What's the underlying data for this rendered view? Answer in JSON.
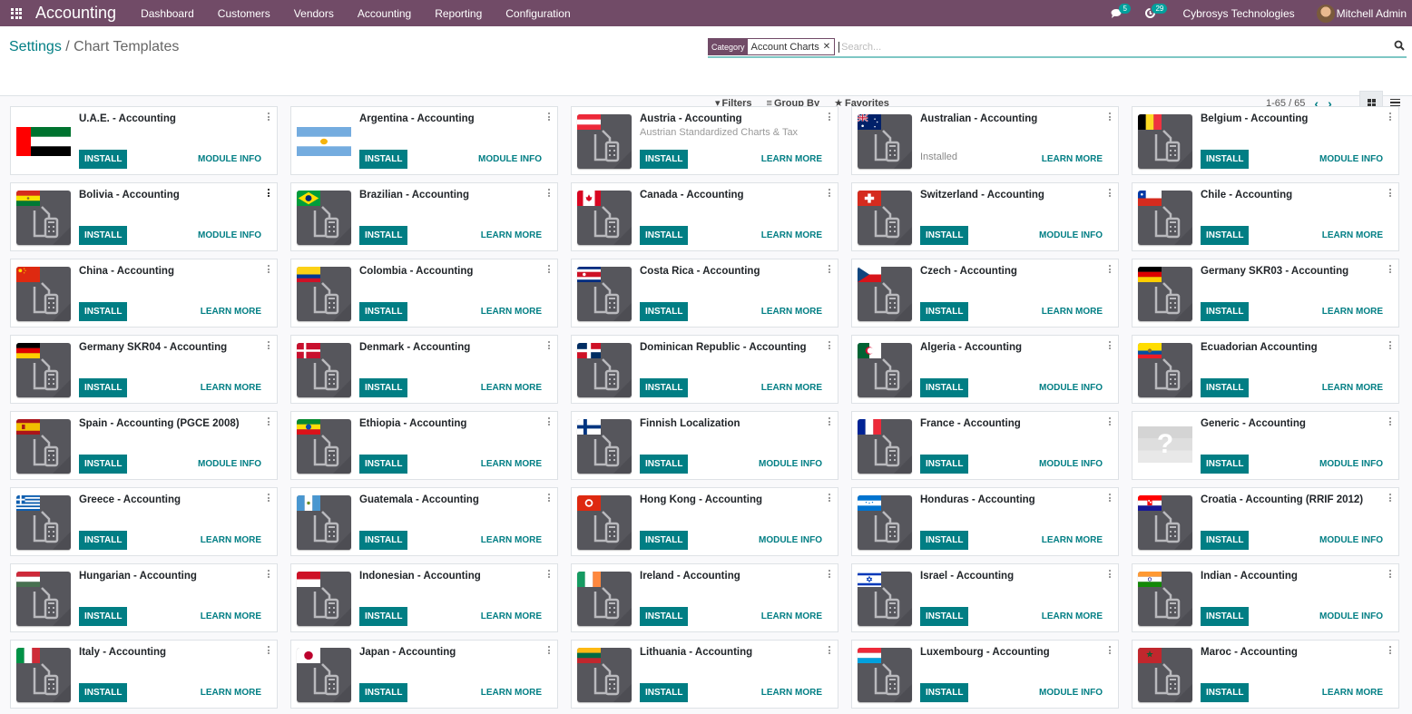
{
  "navbar": {
    "app_title": "Accounting",
    "menu": [
      "Dashboard",
      "Customers",
      "Vendors",
      "Accounting",
      "Reporting",
      "Configuration"
    ],
    "messages_count": "5",
    "activities_count": "29",
    "company": "Cybrosys Technologies",
    "user": "Mitchell Admin"
  },
  "breadcrumb": {
    "parent": "Settings",
    "separator": "/",
    "current": "Chart Templates"
  },
  "search": {
    "facet_label": "Category",
    "facet_value": "Account Charts",
    "placeholder": "Search..."
  },
  "filters": {
    "filters_label": "Filters",
    "groupby_label": "Group By",
    "favorites_label": "Favorites"
  },
  "pager": {
    "text": "1-65 / 65"
  },
  "colors": {
    "brand": "#714b67",
    "primary": "#017e84"
  },
  "cards": [
    {
      "title": "U.A.E. - Accounting",
      "action": "INSTALL",
      "link": "MODULE INFO",
      "flag": "ae",
      "large": true
    },
    {
      "title": "Argentina - Accounting",
      "action": "INSTALL",
      "link": "MODULE INFO",
      "flag": "ar",
      "large": true
    },
    {
      "title": "Austria - Accounting",
      "summary": "Austrian Standardized Charts & Tax",
      "action": "INSTALL",
      "link": "LEARN MORE",
      "flag": "at"
    },
    {
      "title": "Australian - Accounting",
      "status": "Installed",
      "link": "LEARN MORE",
      "flag": "au"
    },
    {
      "title": "Belgium - Accounting",
      "action": "INSTALL",
      "link": "MODULE INFO",
      "flag": "be"
    },
    {
      "title": "Bolivia - Accounting",
      "action": "INSTALL",
      "link": "MODULE INFO",
      "flag": "bo"
    },
    {
      "title": "Brazilian - Accounting",
      "action": "INSTALL",
      "link": "LEARN MORE",
      "flag": "br"
    },
    {
      "title": "Canada - Accounting",
      "action": "INSTALL",
      "link": "LEARN MORE",
      "flag": "ca"
    },
    {
      "title": "Switzerland - Accounting",
      "action": "INSTALL",
      "link": "MODULE INFO",
      "flag": "ch"
    },
    {
      "title": "Chile - Accounting",
      "action": "INSTALL",
      "link": "LEARN MORE",
      "flag": "cl"
    },
    {
      "title": "China - Accounting",
      "action": "INSTALL",
      "link": "LEARN MORE",
      "flag": "cn"
    },
    {
      "title": "Colombia - Accounting",
      "action": "INSTALL",
      "link": "LEARN MORE",
      "flag": "co"
    },
    {
      "title": "Costa Rica - Accounting",
      "action": "INSTALL",
      "link": "LEARN MORE",
      "flag": "cr"
    },
    {
      "title": "Czech - Accounting",
      "action": "INSTALL",
      "link": "LEARN MORE",
      "flag": "cz"
    },
    {
      "title": "Germany SKR03 - Accounting",
      "action": "INSTALL",
      "link": "LEARN MORE",
      "flag": "de"
    },
    {
      "title": "Germany SKR04 - Accounting",
      "action": "INSTALL",
      "link": "LEARN MORE",
      "flag": "de"
    },
    {
      "title": "Denmark - Accounting",
      "action": "INSTALL",
      "link": "LEARN MORE",
      "flag": "dk"
    },
    {
      "title": "Dominican Republic - Accounting",
      "action": "INSTALL",
      "link": "LEARN MORE",
      "flag": "do"
    },
    {
      "title": "Algeria - Accounting",
      "action": "INSTALL",
      "link": "MODULE INFO",
      "flag": "dz"
    },
    {
      "title": "Ecuadorian Accounting",
      "action": "INSTALL",
      "link": "LEARN MORE",
      "flag": "ec"
    },
    {
      "title": "Spain - Accounting (PGCE 2008)",
      "action": "INSTALL",
      "link": "MODULE INFO",
      "flag": "es"
    },
    {
      "title": "Ethiopia - Accounting",
      "action": "INSTALL",
      "link": "LEARN MORE",
      "flag": "et"
    },
    {
      "title": "Finnish Localization",
      "action": "INSTALL",
      "link": "MODULE INFO",
      "flag": "fi"
    },
    {
      "title": "France - Accounting",
      "action": "INSTALL",
      "link": "MODULE INFO",
      "flag": "fr"
    },
    {
      "title": "Generic - Accounting",
      "action": "INSTALL",
      "link": "MODULE INFO",
      "flag": "unknown"
    },
    {
      "title": "Greece - Accounting",
      "action": "INSTALL",
      "link": "LEARN MORE",
      "flag": "gr"
    },
    {
      "title": "Guatemala - Accounting",
      "action": "INSTALL",
      "link": "LEARN MORE",
      "flag": "gt"
    },
    {
      "title": "Hong Kong - Accounting",
      "action": "INSTALL",
      "link": "MODULE INFO",
      "flag": "hk"
    },
    {
      "title": "Honduras - Accounting",
      "action": "INSTALL",
      "link": "LEARN MORE",
      "flag": "hn"
    },
    {
      "title": "Croatia - Accounting (RRIF 2012)",
      "action": "INSTALL",
      "link": "MODULE INFO",
      "flag": "hr"
    },
    {
      "title": "Hungarian - Accounting",
      "action": "INSTALL",
      "link": "LEARN MORE",
      "flag": "hu"
    },
    {
      "title": "Indonesian - Accounting",
      "action": "INSTALL",
      "link": "LEARN MORE",
      "flag": "id"
    },
    {
      "title": "Ireland - Accounting",
      "action": "INSTALL",
      "link": "LEARN MORE",
      "flag": "ie"
    },
    {
      "title": "Israel - Accounting",
      "action": "INSTALL",
      "link": "LEARN MORE",
      "flag": "il"
    },
    {
      "title": "Indian - Accounting",
      "action": "INSTALL",
      "link": "MODULE INFO",
      "flag": "in"
    },
    {
      "title": "Italy - Accounting",
      "action": "INSTALL",
      "link": "LEARN MORE",
      "flag": "it"
    },
    {
      "title": "Japan - Accounting",
      "action": "INSTALL",
      "link": "LEARN MORE",
      "flag": "jp"
    },
    {
      "title": "Lithuania - Accounting",
      "action": "INSTALL",
      "link": "LEARN MORE",
      "flag": "lt"
    },
    {
      "title": "Luxembourg - Accounting",
      "action": "INSTALL",
      "link": "MODULE INFO",
      "flag": "lu"
    },
    {
      "title": "Maroc - Accounting",
      "action": "INSTALL",
      "link": "LEARN MORE",
      "flag": "ma"
    }
  ]
}
